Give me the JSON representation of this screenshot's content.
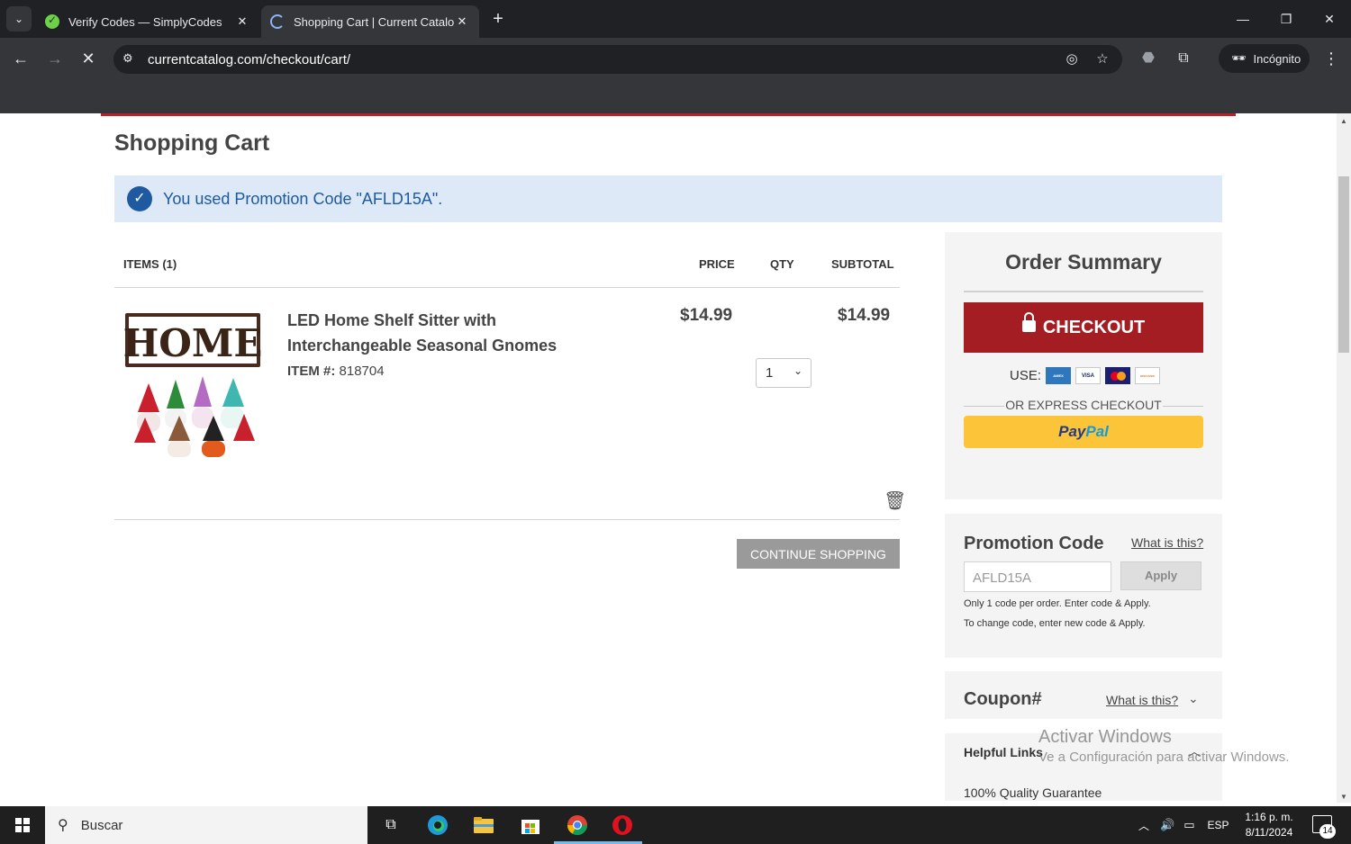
{
  "browser": {
    "tabs": [
      {
        "title": "Verify Codes — SimplyCodes",
        "active": false
      },
      {
        "title": "Shopping Cart | Current Catalog",
        "active": true
      }
    ],
    "url": "currentcatalog.com/checkout/cart/",
    "incognito_label": "Incógnito"
  },
  "page": {
    "title": "Shopping Cart",
    "promo_banner": "You used Promotion Code \"AFLD15A\"."
  },
  "cart": {
    "headers": {
      "items": "ITEMS (1)",
      "price": "PRICE",
      "qty": "QTY",
      "subtotal": "SUBTOTAL"
    },
    "items": [
      {
        "name": "LED Home Shelf Sitter with Interchangeable Seasonal Gnomes",
        "item_label": "ITEM #:",
        "item_number": "818704",
        "price": "$14.99",
        "qty": "1",
        "subtotal": "$14.99",
        "image_text": "HOME"
      }
    ],
    "continue_label": "CONTINUE SHOPPING"
  },
  "summary": {
    "title": "Order Summary",
    "checkout_label": "CHECKOUT",
    "use_label": "USE:",
    "cards": [
      "AMEX",
      "VISA",
      "MASTERCARD",
      "DISCOVER"
    ],
    "express_label": "OR EXPRESS CHECKOUT",
    "paypal_part1": "Pay",
    "paypal_part2": "Pal"
  },
  "promotion": {
    "title": "Promotion Code",
    "what_link": "What is this?",
    "input_value": "AFLD15A",
    "apply_label": "Apply",
    "note1": "Only 1 code per order. Enter code & Apply.",
    "note2": "To change code, enter new code & Apply."
  },
  "coupon": {
    "title": "Coupon#",
    "what_link": "What is this?"
  },
  "helpful": {
    "title": "Helpful Links",
    "first_link": "100% Quality Guarantee"
  },
  "watermark": {
    "line1": "Activar Windows",
    "line2": "Ve a Configuración para activar Windows."
  },
  "taskbar": {
    "search_label": "Buscar",
    "language": "ESP",
    "time": "1:16 p. m.",
    "date": "8/11/2024",
    "notification_count": "14"
  },
  "colors": {
    "brand_red": "#a31d22",
    "banner_blue": "#dde9f7",
    "promo_text_blue": "#1f5aa0",
    "paypal_yellow": "#fcc439"
  }
}
